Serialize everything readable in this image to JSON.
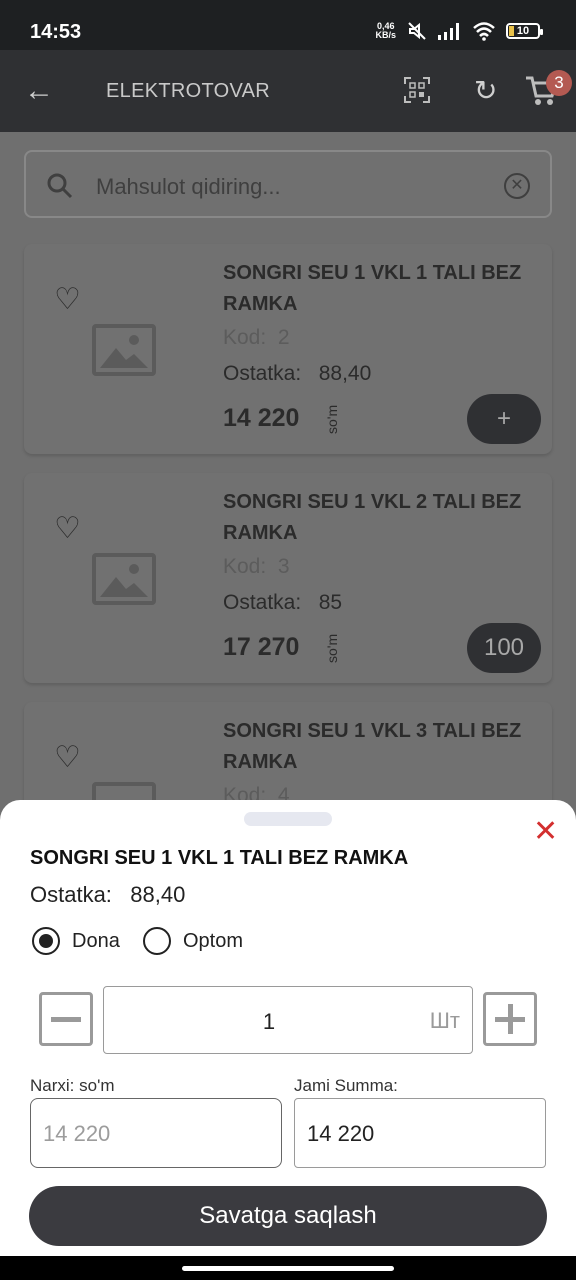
{
  "status": {
    "time": "14:53",
    "net_speed_value": "0,46",
    "net_speed_unit": "KB/s",
    "battery": "10",
    "icons": [
      "mute-icon",
      "signal-icon",
      "wifi-icon",
      "battery-icon"
    ]
  },
  "appbar": {
    "title": "ELEKTROTOVAR",
    "cart_count": "3",
    "icons": [
      "back-arrow-icon",
      "qr-scan-icon",
      "refresh-icon",
      "cart-icon"
    ]
  },
  "search": {
    "placeholder": "Mahsulot qidiring..."
  },
  "products": [
    {
      "name": "SONGRI SEU 1  VKL 1 TALI BEZ RAMKA",
      "kod_label": "Kod:",
      "kod": "2",
      "ostatka_label": "Ostatka:",
      "ostatka": "88,40",
      "price": "14 220",
      "currency": "so'm",
      "action": "+"
    },
    {
      "name": "SONGRI SEU 1 VKL  2 TALI BEZ RAMKA",
      "kod_label": "Kod:",
      "kod": "3",
      "ostatka_label": "Ostatka:",
      "ostatka": "85",
      "price": "17 270",
      "currency": "so'm",
      "action": "100"
    },
    {
      "name": "SONGRI SEU 1 VKL 3 TALI BEZ RAMKA",
      "kod_label": "Kod:",
      "kod": "4"
    }
  ],
  "sheet": {
    "product_name": "SONGRI SEU 1  VKL 1 TALI BEZ RAMKA",
    "ostatka_label": "Ostatka:",
    "ostatka": "88,40",
    "radio_dona": "Dona",
    "radio_optom": "Optom",
    "selected": "Dona",
    "quantity": "1",
    "unit": "Шт",
    "price_label": "Narxi: so'm",
    "price_value": "14 220",
    "total_label": "Jami Summa:",
    "total_value": "14 220",
    "save_label": "Savatga saqlash"
  },
  "colors": {
    "appbar": "#2f3033",
    "overlay": "#6f6f6f",
    "close": "#d32f2f",
    "save_button": "#3b3b40"
  }
}
